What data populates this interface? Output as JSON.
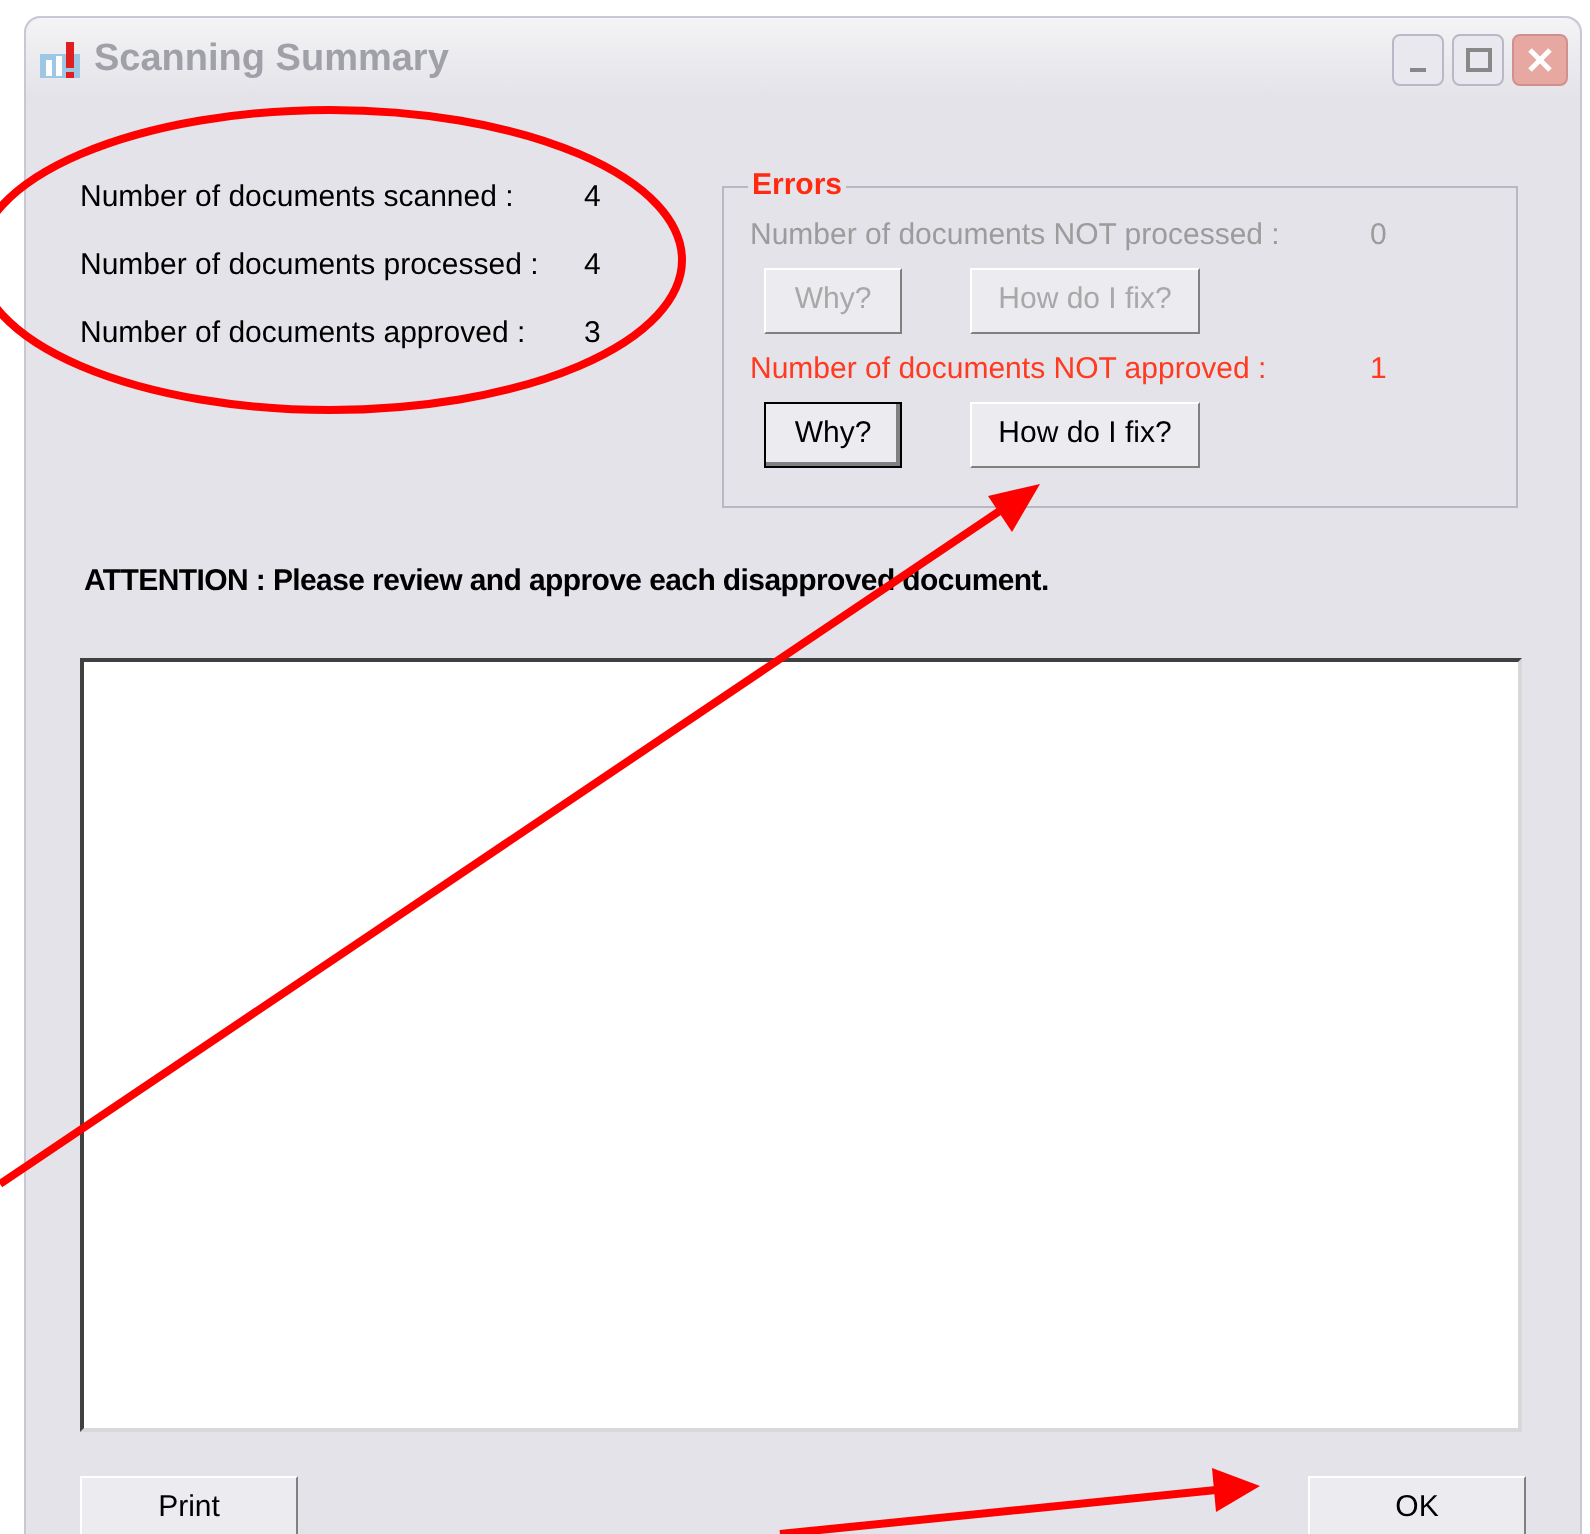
{
  "window": {
    "title": "Scanning Summary"
  },
  "summary": [
    {
      "label": "Number of documents scanned :",
      "value": "4"
    },
    {
      "label": "Number of documents processed :",
      "value": "4"
    },
    {
      "label": "Number of documents approved :",
      "value": "3"
    }
  ],
  "errors": {
    "title": "Errors",
    "rows": [
      {
        "label": "Number of documents NOT processed :",
        "value": "0",
        "disabled": true,
        "buttons": [
          {
            "label": "Why?",
            "focused": false
          },
          {
            "label": "How do I fix?",
            "focused": false
          }
        ]
      },
      {
        "label": "Number of documents NOT approved :",
        "value": "1",
        "disabled": false,
        "buttons": [
          {
            "label": "Why?",
            "focused": true
          },
          {
            "label": "How do I fix?",
            "focused": false
          }
        ]
      }
    ]
  },
  "attention": "ATTENTION : Please review and approve each disapproved document.",
  "buttons": [
    {
      "label": "Print"
    },
    {
      "label": "OK"
    }
  ]
}
